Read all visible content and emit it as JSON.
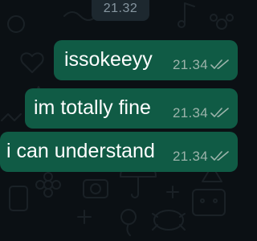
{
  "date_chip": {
    "label": "21.32"
  },
  "messages": [
    {
      "text": "issokeeyy",
      "time": "21.34",
      "status": "read",
      "icon": "double-check-icon"
    },
    {
      "text": "im totally fine",
      "time": "21.34",
      "status": "read",
      "icon": "double-check-icon"
    },
    {
      "text": "i can understand",
      "time": "21.34",
      "status": "read",
      "icon": "double-check-icon"
    }
  ],
  "colors": {
    "background": "#0b1014",
    "outgoing_bubble": "#105b45",
    "message_text": "#ffffff",
    "meta_text": "#9bb3aa",
    "date_chip": "#1d282f"
  }
}
